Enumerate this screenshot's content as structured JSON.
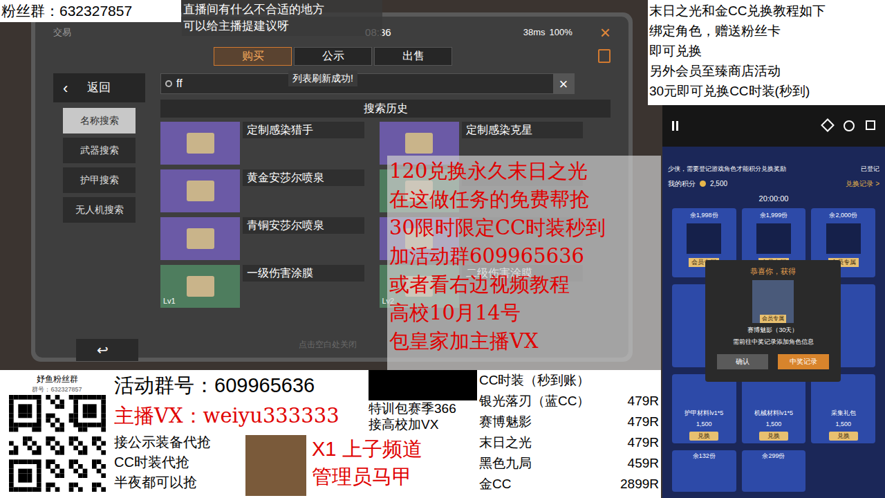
{
  "fan_group": "粉丝群：632327857",
  "notice": [
    "直播间有什么不合适的地方",
    "可以给主播提建议呀"
  ],
  "top_right_info": [
    "末日之光和金CC兑换教程如下",
    "绑定角色，赠送粉丝卡",
    "即可兑换",
    "另外会员至臻商店活动",
    "30元即可兑换CC时装(秒到)"
  ],
  "game": {
    "title": "交易",
    "time": "08:36",
    "signal": "38ms",
    "battery": "100%",
    "close": "×",
    "tabs": [
      {
        "label": "购买",
        "selected": true
      },
      {
        "label": "公示",
        "selected": false
      },
      {
        "label": "出售",
        "selected": false
      }
    ],
    "back": "返回",
    "sidebar": [
      {
        "label": "名称搜索",
        "selected": true
      },
      {
        "label": "武器搜索",
        "selected": false
      },
      {
        "label": "护甲搜索",
        "selected": false
      },
      {
        "label": "无人机搜索",
        "selected": false
      }
    ],
    "search": {
      "value": "ff",
      "clear": "×"
    },
    "toast": "列表刷新成功!",
    "history_title": "搜索历史",
    "items": [
      {
        "name": "定制感染猎手",
        "level": "",
        "color": "#6b5aa6"
      },
      {
        "name": "定制感染克星",
        "level": "",
        "color": "#6b5aa6"
      },
      {
        "name": "黄金安莎尔喷泉",
        "level": "",
        "color": "#6b5aa6"
      },
      {
        "name": "",
        "level": "",
        "color": "#4e7d5e"
      },
      {
        "name": "青铜安莎尔喷泉",
        "level": "",
        "color": "#6b5aa6"
      },
      {
        "name": "",
        "level": "",
        "color": "#6b5aa6"
      },
      {
        "name": "一级伤害涂膜",
        "level": "Lv1",
        "color": "#4e7d5e"
      },
      {
        "name": "二级伤害涂膜",
        "level": "Lv2",
        "color": "#4e7d5e"
      }
    ],
    "footer_hint": "点击空白处关闭",
    "return_icon": "↩"
  },
  "promo_overlay": [
    "120兑换永久末日之光",
    "在这做任务的免费帮抢",
    "30限时限定CC时装秒到",
    "加活动群609965636",
    "或者看右边视频教程",
    "高校10月14号",
    "包皇家加主播VX"
  ],
  "phone": {
    "banner": "少侠，需要登记游戏角色才能积分兑换奖励",
    "registered": "已登记",
    "points_label": "我的积分",
    "points": "2,500",
    "records_link": "兑换记录 >",
    "section_time": "20:00:00",
    "top_cards": [
      {
        "stock": "余1,998份",
        "tag": "会员专属"
      },
      {
        "stock": "余1,999份",
        "tag": "会员专属"
      },
      {
        "stock": "余2,000份",
        "tag": "会员专属"
      }
    ],
    "material_cards": [
      {
        "name": "护甲材料lv1*5",
        "price": "1,500",
        "button": "兑换"
      },
      {
        "name": "机械材料lv1*5",
        "price": "1,500",
        "button": "兑换"
      },
      {
        "name": "采集礼包",
        "price": "1,500",
        "button": "兑换"
      }
    ],
    "bottom_stock": [
      "余132份",
      "余299份"
    ],
    "popup": {
      "title": "恭喜你，获得",
      "tag": "会员专属",
      "prize": "赛博魅影（30天）",
      "hint": "需前往中奖记录添加角色信息",
      "confirm": "确认",
      "records": "中奖记录"
    }
  },
  "qr": {
    "title": "妤鱼粉丝群",
    "number": "群号：632327857"
  },
  "activity_group": "活动群号：609965636",
  "streamer_vx": "主播VX：weiyu333333",
  "services": [
    "接公示装备代抢",
    "CC时装代抢",
    "半夜都可以抢"
  ],
  "side_notes": [
    "特训包赛季366",
    "接高校加VX"
  ],
  "admin_label": [
    "X1 上子频道",
    "管理员马甲"
  ],
  "price_list": {
    "title": "CC时装（秒到账）",
    "rows": [
      {
        "name": "银光落刃（蓝CC）",
        "price": "479R"
      },
      {
        "name": "赛博魅影",
        "price": "479R"
      },
      {
        "name": "末日之光",
        "price": "479R"
      },
      {
        "name": "黑色九局",
        "price": "459R"
      },
      {
        "name": "金CC",
        "price": "2899R"
      }
    ]
  }
}
